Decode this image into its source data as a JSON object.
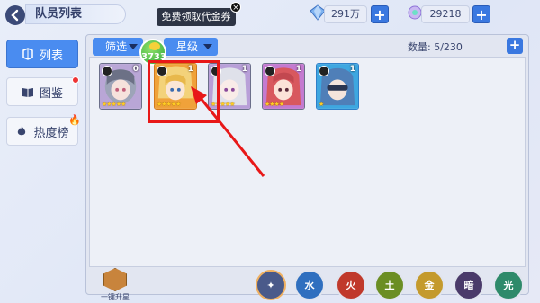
{
  "header": {
    "title": "队员列表"
  },
  "currencies": [
    {
      "name": "diamond",
      "value": "291万",
      "icon": "diamond-icon"
    },
    {
      "name": "crystal",
      "value": "29218",
      "icon": "crystal-icon"
    }
  ],
  "tooltip": {
    "text": "免费领取代金券",
    "close": "×"
  },
  "coin_bubble": {
    "value": "3733"
  },
  "sidebar": {
    "items": [
      {
        "label": "列表",
        "icon": "list-icon",
        "active": true
      },
      {
        "label": "图鉴",
        "icon": "book-icon",
        "badge": "red-dot"
      },
      {
        "label": "热度榜",
        "icon": "flame-icon",
        "badge": "fire"
      }
    ]
  },
  "filters": {
    "filter_label": "筛选",
    "grade_label": "星级"
  },
  "count": {
    "label": "数量: 5/230"
  },
  "add_label": "+",
  "cards": [
    {
      "level": "0",
      "stars": "★★★★★",
      "frame": "purple",
      "selected": false
    },
    {
      "level": "1",
      "stars": "★★★★★",
      "frame": "orange",
      "selected": true
    },
    {
      "level": "1",
      "stars": "★★★★★",
      "frame": "purple",
      "selected": false
    },
    {
      "level": "1",
      "stars": "★★★★",
      "frame": "purple",
      "selected": false
    },
    {
      "level": "1",
      "stars": "★",
      "frame": "blue",
      "selected": false
    }
  ],
  "bottom": {
    "onekey_label": "一键升星",
    "elements": [
      {
        "name": "all",
        "glyph": "✦",
        "color": "#4a5a8a"
      },
      {
        "name": "water",
        "glyph": "水",
        "color": "#2f6fbf"
      },
      {
        "name": "fire",
        "glyph": "火",
        "color": "#c0392b"
      },
      {
        "name": "earth",
        "glyph": "土",
        "color": "#6b8e23"
      },
      {
        "name": "gold",
        "glyph": "金",
        "color": "#c49a2c"
      },
      {
        "name": "dark",
        "glyph": "暗",
        "color": "#4a3a6a"
      },
      {
        "name": "light",
        "glyph": "光",
        "color": "#2e8a6a"
      }
    ]
  }
}
